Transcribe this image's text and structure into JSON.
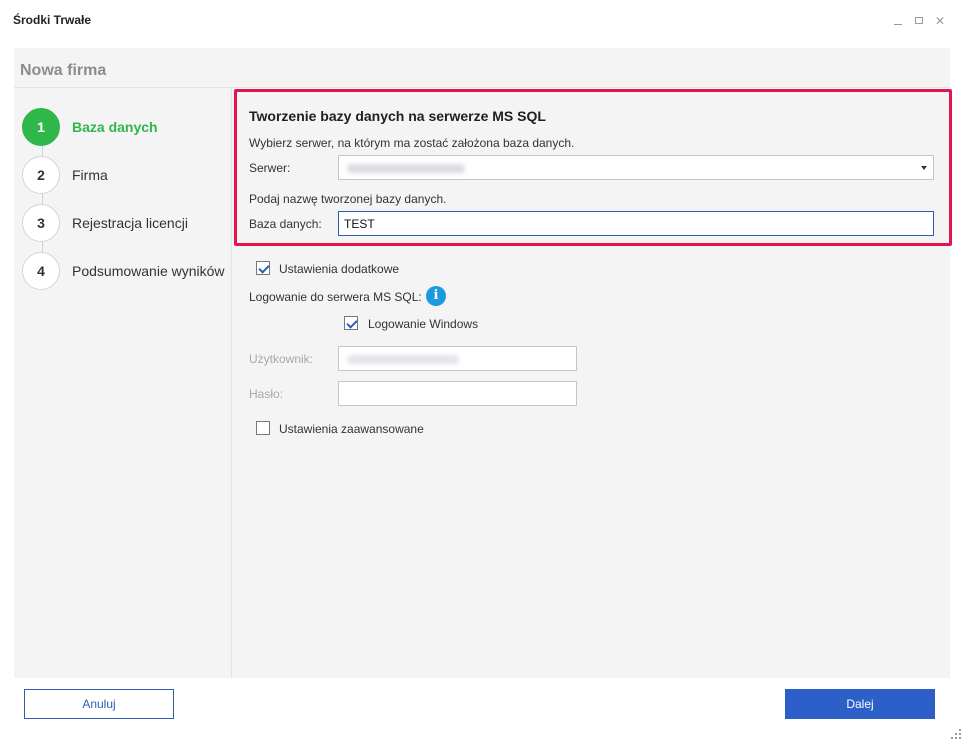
{
  "window": {
    "title": "Środki Trwałe",
    "page_title": "Nowa firma"
  },
  "steps": [
    {
      "number": "1",
      "label": "Baza danych",
      "active": true
    },
    {
      "number": "2",
      "label": "Firma",
      "active": false
    },
    {
      "number": "3",
      "label": "Rejestracja licencji",
      "active": false
    },
    {
      "number": "4",
      "label": "Podsumowanie wyników",
      "active": false
    }
  ],
  "database_section": {
    "title": "Tworzenie bazy danych na serwerze MS SQL",
    "server_hint": "Wybierz serwer, na którym ma zostać założona baza danych.",
    "server_label": "Serwer:",
    "db_hint": "Podaj nazwę tworzonej bazy danych.",
    "db_label": "Baza danych:",
    "db_value": "TEST"
  },
  "options": {
    "extra_settings_label": "Ustawienia dodatkowe",
    "extra_settings_checked": true,
    "login_label": "Logowanie do serwera MS SQL:",
    "windows_login_label": "Logowanie Windows",
    "windows_login_checked": true,
    "user_label": "Użytkownik:",
    "password_label": "Hasło:",
    "advanced_label": "Ustawienia zaawansowane",
    "advanced_checked": false
  },
  "buttons": {
    "cancel": "Anuluj",
    "next": "Dalej"
  },
  "colors": {
    "active_step": "#2fb74a",
    "primary": "#2d5fc9",
    "highlight": "#e0174f",
    "info": "#1a9be0"
  }
}
